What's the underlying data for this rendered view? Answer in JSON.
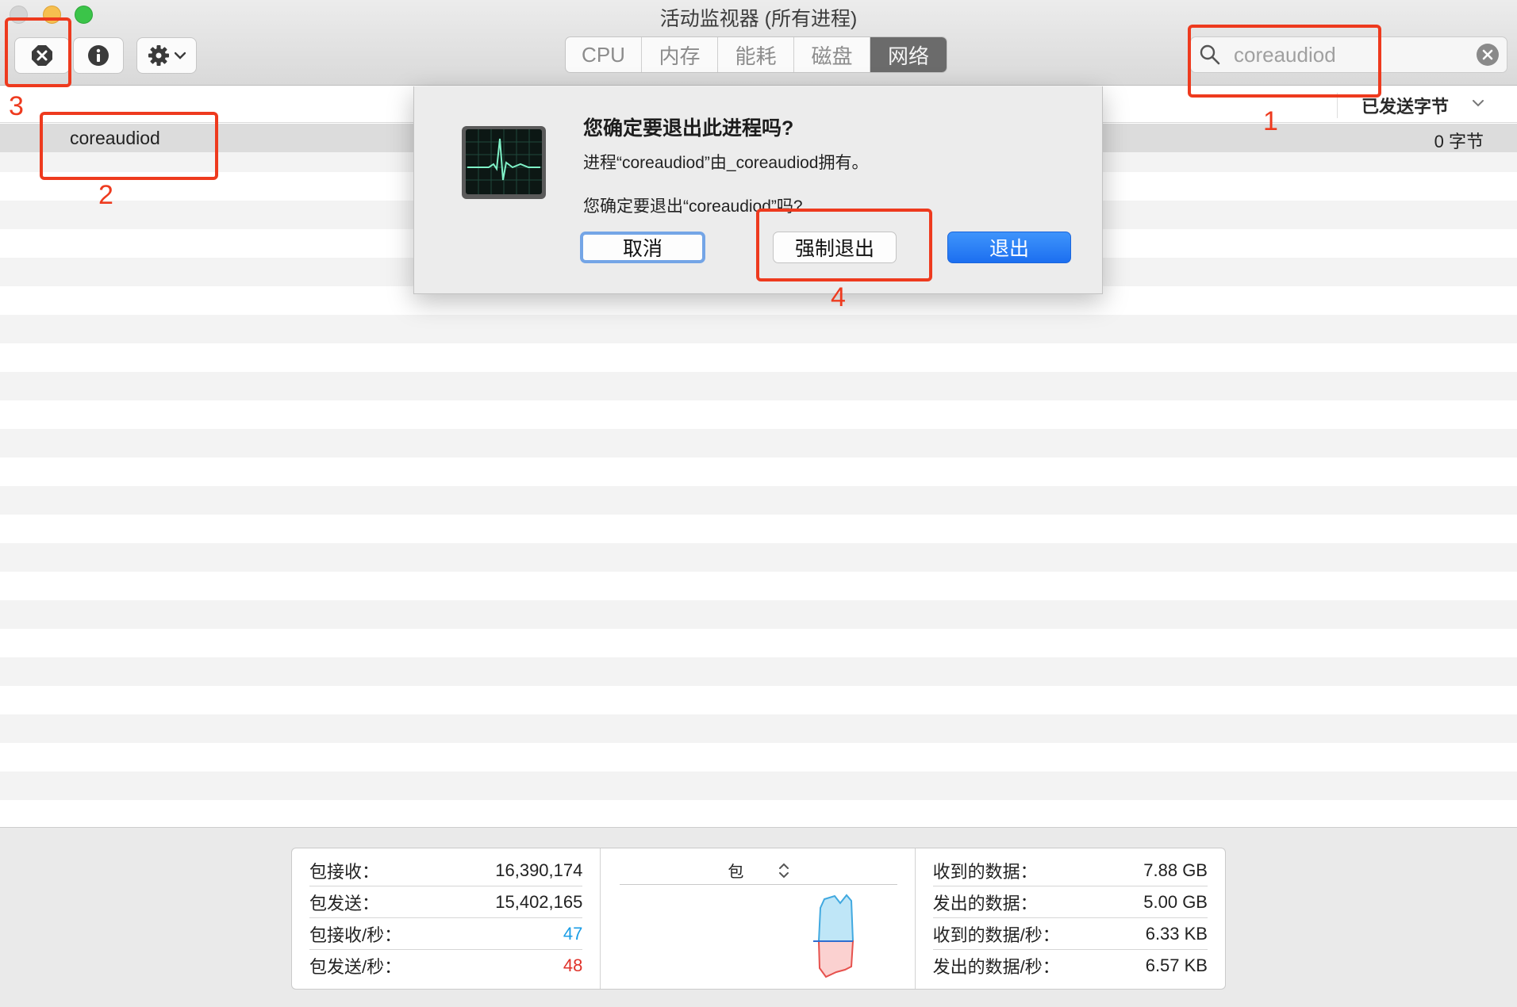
{
  "window": {
    "title": "活动监视器 (所有进程)"
  },
  "toolbar": {
    "tabs": [
      {
        "label": "CPU",
        "active": false
      },
      {
        "label": "内存",
        "active": false
      },
      {
        "label": "能耗",
        "active": false
      },
      {
        "label": "磁盘",
        "active": false
      },
      {
        "label": "网络",
        "active": true
      }
    ],
    "search": {
      "value": "coreaudiod"
    }
  },
  "table": {
    "column_header": "已发送字节",
    "rows": [
      {
        "name": "coreaudiod",
        "sent_bytes": "0 字节"
      }
    ]
  },
  "stats": {
    "left": [
      {
        "label": "包接收：",
        "value": "16,390,174"
      },
      {
        "label": "包发送：",
        "value": "15,402,165"
      },
      {
        "label": "包接收/秒：",
        "value": "47"
      },
      {
        "label": "包发送/秒：",
        "value": "48"
      }
    ],
    "graph_selector": "包",
    "right": [
      {
        "label": "收到的数据：",
        "value": "7.88 GB"
      },
      {
        "label": "发出的数据：",
        "value": "5.00 GB"
      },
      {
        "label": "收到的数据/秒：",
        "value": "6.33 KB"
      },
      {
        "label": "发出的数据/秒：",
        "value": "6.57 KB"
      }
    ]
  },
  "dialog": {
    "title": "您确定要退出此进程吗?",
    "message1": "进程“coreaudiod”由_coreaudiod拥有。",
    "message2": "您确定要退出“coreaudiod”吗?",
    "buttons": {
      "cancel": "取消",
      "force_quit": "强制退出",
      "quit": "退出"
    }
  },
  "annotations": [
    "1",
    "2",
    "3",
    "4"
  ],
  "colors": {
    "accent": "#1c6ff0",
    "annotation": "#ee3a1e",
    "rx_rate": "#1a9de6",
    "tx_rate": "#e0322a"
  }
}
